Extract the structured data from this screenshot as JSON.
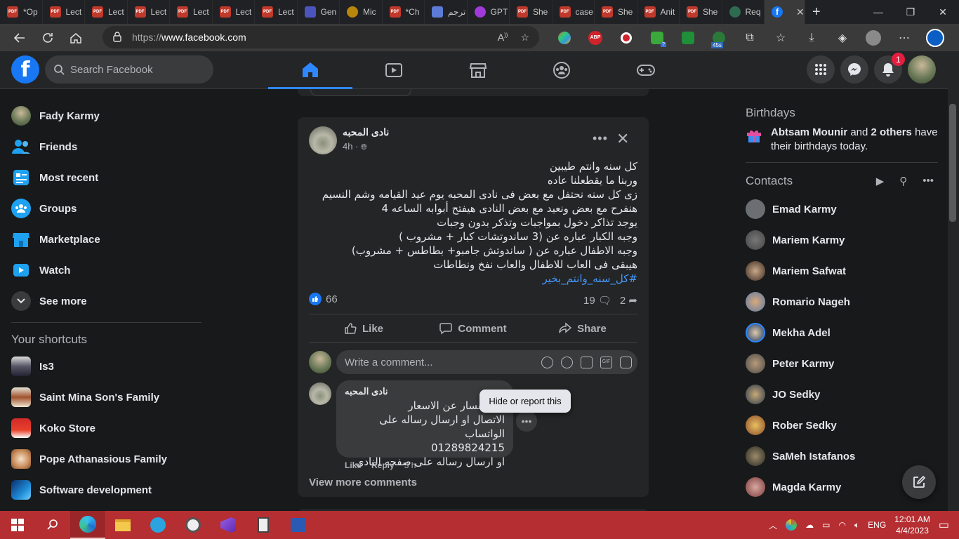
{
  "browser": {
    "tabs": [
      {
        "label": "*Op",
        "icon": "pdf-icon"
      },
      {
        "label": "Lect",
        "icon": "pdf-icon"
      },
      {
        "label": "Lect",
        "icon": "pdf-icon"
      },
      {
        "label": "Lect",
        "icon": "pdf-icon"
      },
      {
        "label": "Lect",
        "icon": "pdf-icon"
      },
      {
        "label": "Lect",
        "icon": "pdf-icon"
      },
      {
        "label": "Lect",
        "icon": "pdf-icon"
      },
      {
        "label": "Gen",
        "icon": "teams-icon"
      },
      {
        "label": "Mic",
        "icon": "medal-icon"
      },
      {
        "label": "*Ch",
        "icon": "pdf-icon"
      },
      {
        "label": "ترجم",
        "icon": "translate-icon"
      },
      {
        "label": "GPT",
        "icon": "bot-icon"
      },
      {
        "label": "She",
        "icon": "pdf-icon"
      },
      {
        "label": "case",
        "icon": "pdf-icon"
      },
      {
        "label": "She",
        "icon": "pdf-icon"
      },
      {
        "label": "Anit",
        "icon": "pdf-icon"
      },
      {
        "label": "She",
        "icon": "pdf-icon"
      },
      {
        "label": "Req",
        "icon": "globe-icon"
      }
    ],
    "url_prefix": "https://",
    "url_host": "www.facebook.com",
    "pdf_label": "PDF",
    "ext_abp": "ABP",
    "ext_counter": "45s",
    "ext_q": "?"
  },
  "fb": {
    "logo": "f",
    "search_placeholder": "Search Facebook",
    "notif_count": "1"
  },
  "left": {
    "profile": "Fady Karmy",
    "items": [
      "Friends",
      "Most recent",
      "Groups",
      "Marketplace",
      "Watch",
      "See more"
    ],
    "shortcuts_title": "Your shortcuts",
    "shortcuts": [
      "Is3",
      "Saint Mina Son's Family",
      "Koko Store",
      "Pope Athanasious Family",
      "Software development"
    ]
  },
  "post": {
    "author": "نادى المحبه",
    "time": "4h ·",
    "lines": [
      "كل سنه وانتم طيبين",
      "وربنا ما يقطعلنا عاده",
      "زى كل سنه نحتفل مع بعض فى نادى المحبه يوم عيد القيامه وشم النسيم",
      "هنفرح مع بعض ونعيد مع بعض النادى هيفتح أبوابه الساعه 4",
      "يوجد تذاكر دخول بمواجبات وتذكر بدون وجبات",
      "وجبه الكبار عباره عن (3 ساندوتشات كبار + مشروب )",
      "وجبه الاطفال عباره عن ( ساندوتش جامبو+ بطاطس + مشروب)",
      "هيبقى فى العاب للاطفال والعاب نفخ ونطاطات"
    ],
    "hashtag": "#كل_سنه_وانتم_بخير",
    "likes": "66",
    "comments": "19",
    "shares": "2",
    "actions": {
      "like": "Like",
      "comment": "Comment",
      "share": "Share"
    },
    "comment_placeholder": "Write a comment...",
    "gif_label": "GIF",
    "comment": {
      "author": "نادى المحبه",
      "lines": [
        "للاستفسار عن الاسعار",
        "الاتصال او ارسال رساله على الواتساب",
        "01289824215",
        "او ارسال رساله على صفحه النادى"
      ],
      "like": "Like",
      "reply": "Reply",
      "time": "3 h"
    },
    "tooltip": "Hide or report this",
    "view_more": "View more comments"
  },
  "right": {
    "birthdays_title": "Birthdays",
    "bday_name": "Abtsam Mounir",
    "bday_and": " and ",
    "bday_others": "2 others",
    "bday_rest": " have their birthdays today.",
    "contacts_title": "Contacts",
    "contacts": [
      "Emad Karmy",
      "Mariem Karmy",
      "Mariem Safwat",
      "Romario Nageh",
      "Mekha Adel",
      "Peter Karmy",
      "JO Sedky",
      "Rober Sedky",
      "SaMeh Istafanos",
      "Magda Karmy"
    ]
  },
  "taskbar": {
    "lang": "ENG",
    "time": "12:01 AM",
    "date": "4/4/2023"
  },
  "colors": {
    "accent": "#2d88ff",
    "fb_blue": "#1877f2",
    "taskbar": "#b52e31",
    "badge": "#e41e3f"
  }
}
